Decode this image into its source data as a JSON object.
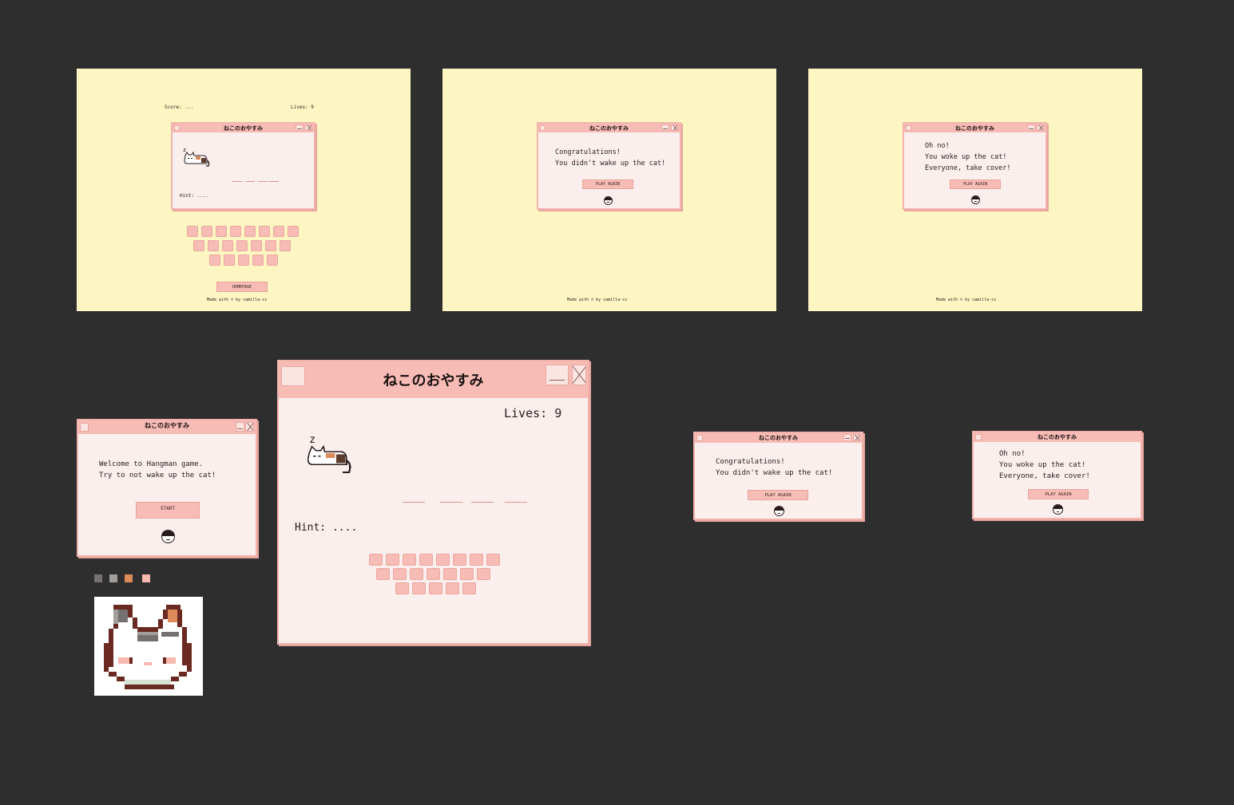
{
  "app": {
    "window_title": "ねこのおやすみ"
  },
  "game": {
    "score_label": "Score: ...",
    "lives_label": "Lives: 9",
    "hint_label": "Hint: ....",
    "word_blanks": 4,
    "keyboard_rows": [
      8,
      7,
      5
    ],
    "homepage_label": "HOMEPAGE",
    "footer": "Made with ☺ by camilla-cs"
  },
  "welcome": {
    "line1": "Welcome to Hangman game.",
    "line2": "Try to not wake up the cat!",
    "start_label": "START"
  },
  "win": {
    "line1": "Congratulations!",
    "line2": "You didn't wake up the cat!",
    "play_again_label": "PLAY AGAIN"
  },
  "lose": {
    "line1": "Oh no!",
    "line2": "You woke up the cat!",
    "line3": "Everyone, take cover!",
    "play_again_label": "PLAY AGAIN"
  },
  "palette": [
    "#757170",
    "#a29e9b",
    "#df8a5b",
    "#f8b8ad"
  ],
  "icons": {
    "cat": "sleeping-cat-icon",
    "emoji": "face-emoji-icon",
    "cat_face": "cat-face-icon"
  }
}
